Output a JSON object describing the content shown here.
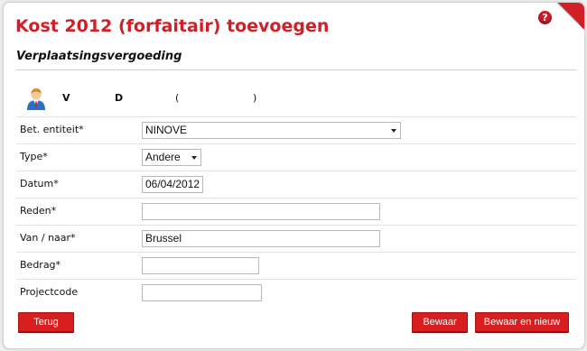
{
  "header": {
    "title": "Kost 2012 (forfaitair) toevoegen",
    "help_glyph": "?"
  },
  "section": {
    "subtitle": "Verplaatsingsvergoeding"
  },
  "person": {
    "first": "V",
    "last": "D",
    "paren_open": "(",
    "paren_close": ")",
    "avatar_icon": "user-avatar-icon"
  },
  "form": {
    "entity": {
      "label": "Bet. entiteit*",
      "value": "NINOVE"
    },
    "type": {
      "label": "Type*",
      "value": "Andere"
    },
    "date": {
      "label": "Datum*",
      "value": "06/04/2012"
    },
    "reason": {
      "label": "Reden*",
      "value": ""
    },
    "route": {
      "label": "Van / naar*",
      "value": "Brussel"
    },
    "amount": {
      "label": "Bedrag*",
      "value": ""
    },
    "project": {
      "label": "Projectcode",
      "value": ""
    }
  },
  "buttons": {
    "back": "Terug",
    "save": "Bewaar",
    "save_new": "Bewaar en nieuw"
  },
  "colors": {
    "accent": "#d01f27",
    "button": "#d81e1e"
  }
}
